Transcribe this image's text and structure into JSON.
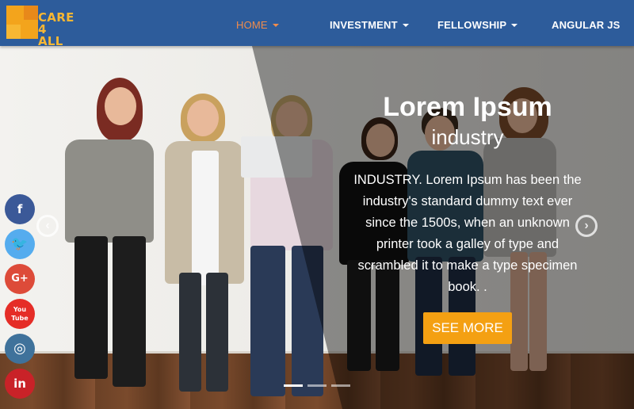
{
  "brand": {
    "line1": "CARE",
    "line2": "4 ALL"
  },
  "nav": {
    "items": [
      {
        "label": "HOME",
        "dropdown": true,
        "active": true
      },
      {
        "label": "INVESTMENT",
        "dropdown": true,
        "active": false
      },
      {
        "label": "FELLOWSHIP",
        "dropdown": true,
        "active": false
      },
      {
        "label": "ANGULAR JS",
        "dropdown": false,
        "active": false
      }
    ]
  },
  "hero": {
    "title": "Lorem Ipsum",
    "subtitle": "industry",
    "body": "INDUSTRY. Lorem Ipsum has been the industry's standard dummy text ever since the 1500s, when an unknown printer took a galley of type and scrambled it to make a type specimen book. .",
    "button_label": "SEE MORE",
    "prev_icon": "chevron-left-circle-icon",
    "next_icon": "chevron-right-circle-icon",
    "slides_total": 3,
    "slide_active": 1
  },
  "social": [
    {
      "name": "facebook",
      "glyph": "f",
      "color": "#3b5998"
    },
    {
      "name": "twitter",
      "glyph": "🐦",
      "color": "#55acee"
    },
    {
      "name": "google-plus",
      "glyph": "G+",
      "color": "#dd4b39"
    },
    {
      "name": "youtube",
      "glyph": "You Tube",
      "color": "#e52d27"
    },
    {
      "name": "instagram",
      "glyph": "◎",
      "color": "#3f729b"
    },
    {
      "name": "linkedin",
      "glyph": "in",
      "color": "#c92228"
    }
  ],
  "colors": {
    "navbar": "#2d5c9b",
    "nav_active": "#f08c4c",
    "button": "#f4a012",
    "logo": "#f7b733"
  }
}
